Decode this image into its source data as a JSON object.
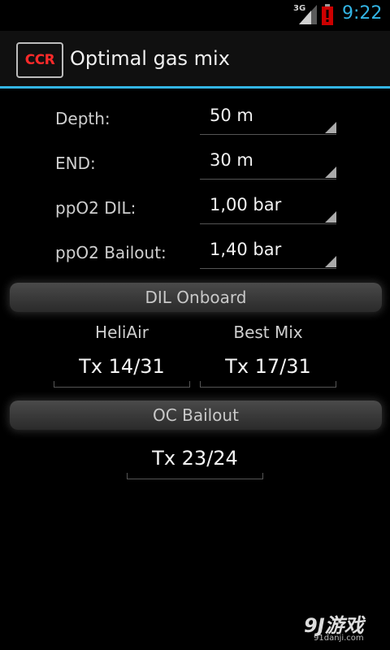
{
  "status_bar": {
    "network": "3G",
    "time": "9:22",
    "colors": {
      "clock": "#33b5e5",
      "battery_warning": "#cc0000"
    }
  },
  "action_bar": {
    "logo_text": "CCR",
    "title": "Optimal gas mix",
    "colors": {
      "accent": "#33b5e5",
      "logo_text": "#ff2a2a"
    }
  },
  "form": {
    "depth": {
      "label": "Depth:",
      "value": "50 m"
    },
    "end": {
      "label": "END:",
      "value": "30 m"
    },
    "ppo2_dil": {
      "label": "ppO2 DIL:",
      "value": "1,00 bar"
    },
    "ppo2_bailout": {
      "label": "ppO2 Bailout:",
      "value": "1,40 bar"
    }
  },
  "dil_onboard": {
    "title": "DIL Onboard",
    "heliair": {
      "label": "HeliAir",
      "value": "Tx 14/31"
    },
    "best_mix": {
      "label": "Best Mix",
      "value": "Tx 17/31"
    }
  },
  "oc_bailout": {
    "title": "OC Bailout",
    "value": "Tx 23/24"
  },
  "watermark": {
    "main": "9J游戏",
    "sub": "91danji.com"
  }
}
